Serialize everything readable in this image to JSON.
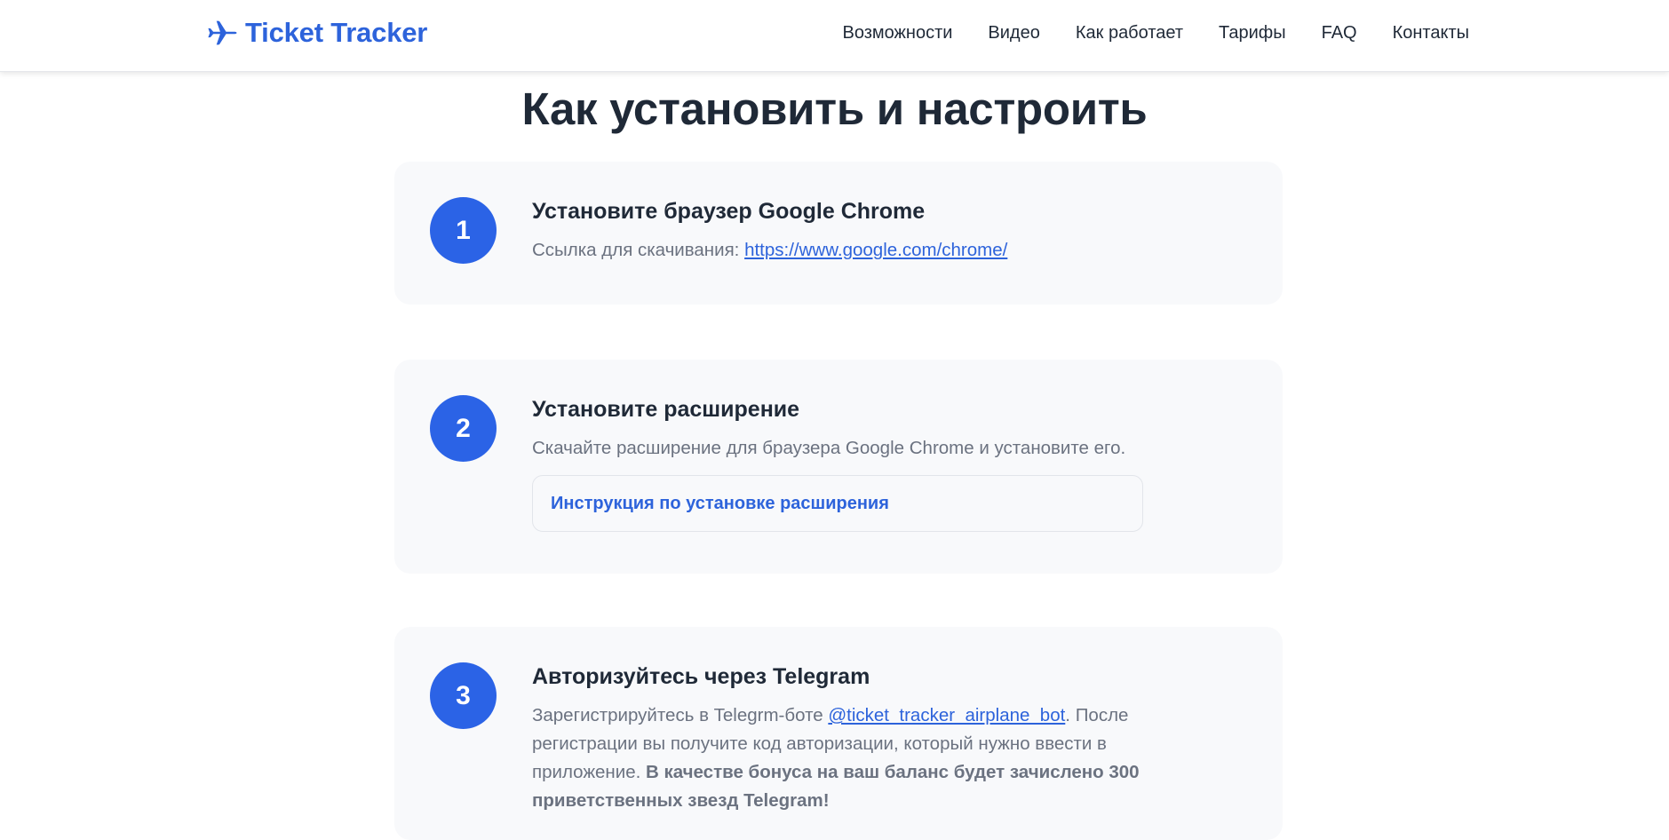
{
  "header": {
    "logo_text": "Ticket Tracker",
    "logo_icon": "airplane-icon",
    "brand_color": "#2d63db",
    "nav": [
      {
        "label": "Возможности"
      },
      {
        "label": "Видео"
      },
      {
        "label": "Как работает"
      },
      {
        "label": "Тарифы"
      },
      {
        "label": "FAQ"
      },
      {
        "label": "Контакты"
      }
    ]
  },
  "section": {
    "title": "Как установить и настроить"
  },
  "steps": [
    {
      "number": "1",
      "title": "Установите браузер Google Chrome",
      "desc_prefix": "Ссылка для скачивания: ",
      "link_text": "https://www.google.com/chrome/"
    },
    {
      "number": "2",
      "title": "Установите расширение",
      "desc": "Скачайте расширение для браузера Google Chrome и установите его.",
      "button_label": "Инструкция по установке расширения"
    },
    {
      "number": "3",
      "title": "Авторизуйтесь через Telegram",
      "desc_prefix": "Зарегистрируйтесь в Telegrm-боте ",
      "link_text": "@ticket_tracker_airplane_bot",
      "desc_middle": ". После регистрации вы получите код авторизации, который нужно ввести в приложение. ",
      "desc_bold": "В качестве бонуса на ваш баланс будет зачислено 300 приветственных звезд Telegram!"
    }
  ],
  "colors": {
    "accent": "#2b63e6",
    "card_bg": "#f8f9fb",
    "text_dark": "#1f2937",
    "text_muted": "#6b7280"
  }
}
